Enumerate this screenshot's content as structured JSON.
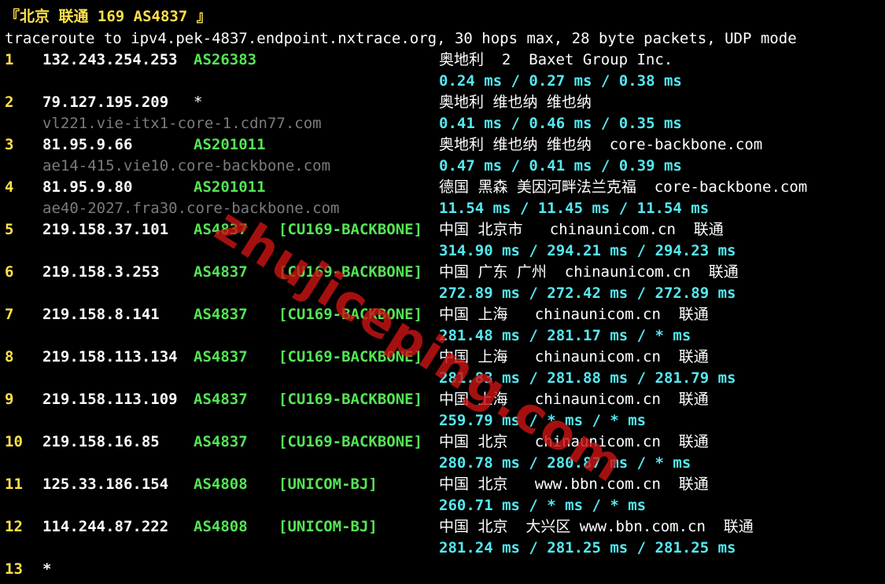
{
  "header": {
    "title": "『北京 联通 169 AS4837 』",
    "command": "traceroute to ipv4.pek-4837.endpoint.nxtrace.org, 30 hops max, 28 byte packets, UDP mode"
  },
  "hops": [
    {
      "n": "1",
      "ip": "132.243.254.253",
      "as": "AS26383",
      "tag": "",
      "geo": "奥地利  2  Baxet Group Inc.",
      "host": "",
      "lat": "0.24 ms / 0.27 ms / 0.38 ms"
    },
    {
      "n": "2",
      "ip": "79.127.195.209",
      "as": "*",
      "tag": "",
      "geo": "奥地利 维也纳 维也纳",
      "host": "vl221.vie-itx1-core-1.cdn77.com",
      "lat": "0.41 ms / 0.46 ms / 0.35 ms"
    },
    {
      "n": "3",
      "ip": "81.95.9.66",
      "as": "AS201011",
      "tag": "",
      "geo": "奥地利 维也纳 维也纳  core-backbone.com",
      "host": "ae14-415.vie10.core-backbone.com",
      "lat": "0.47 ms / 0.41 ms / 0.39 ms"
    },
    {
      "n": "4",
      "ip": "81.95.9.80",
      "as": "AS201011",
      "tag": "",
      "geo": "德国 黑森 美因河畔法兰克福  core-backbone.com",
      "host": "ae40-2027.fra30.core-backbone.com",
      "lat": "11.54 ms / 11.45 ms / 11.54 ms"
    },
    {
      "n": "5",
      "ip": "219.158.37.101",
      "as": "AS4837",
      "tag": "[CU169-BACKBONE]",
      "geo": "中国 北京市   chinaunicom.cn  联通",
      "host": "",
      "lat": "314.90 ms / 294.21 ms / 294.23 ms"
    },
    {
      "n": "6",
      "ip": "219.158.3.253",
      "as": "AS4837",
      "tag": "[CU169-BACKBONE]",
      "geo": "中国 广东 广州  chinaunicom.cn  联通",
      "host": "",
      "lat": "272.89 ms / 272.42 ms / 272.89 ms"
    },
    {
      "n": "7",
      "ip": "219.158.8.141",
      "as": "AS4837",
      "tag": "[CU169-BACKBONE]",
      "geo": "中国 上海   chinaunicom.cn  联通",
      "host": "",
      "lat": "281.48 ms / 281.17 ms / * ms"
    },
    {
      "n": "8",
      "ip": "219.158.113.134",
      "as": "AS4837",
      "tag": "[CU169-BACKBONE]",
      "geo": "中国 上海   chinaunicom.cn  联通",
      "host": "",
      "lat": "281.83 ms / 281.88 ms / 281.79 ms"
    },
    {
      "n": "9",
      "ip": "219.158.113.109",
      "as": "AS4837",
      "tag": "[CU169-BACKBONE]",
      "geo": "中国 上海   chinaunicom.cn  联通",
      "host": "",
      "lat": "259.79 ms / * ms / * ms"
    },
    {
      "n": "10",
      "ip": "219.158.16.85",
      "as": "AS4837",
      "tag": "[CU169-BACKBONE]",
      "geo": "中国 北京   chinaunicom.cn  联通",
      "host": "",
      "lat": "280.78 ms / 280.87 ms / * ms"
    },
    {
      "n": "11",
      "ip": "125.33.186.154",
      "as": "AS4808",
      "tag": "[UNICOM-BJ]",
      "geo": "中国 北京   www.bbn.com.cn  联通",
      "host": "",
      "lat": "260.71 ms / * ms / * ms"
    },
    {
      "n": "12",
      "ip": "114.244.87.222",
      "as": "AS4808",
      "tag": "[UNICOM-BJ]",
      "geo": "中国 北京  大兴区 www.bbn.com.cn  联通",
      "host": "",
      "lat": "281.24 ms / 281.25 ms / 281.25 ms"
    },
    {
      "n": "13",
      "ip": "*",
      "as": "",
      "tag": "",
      "geo": "",
      "host": "",
      "lat": ""
    }
  ],
  "watermark": "zhujiceping.com"
}
